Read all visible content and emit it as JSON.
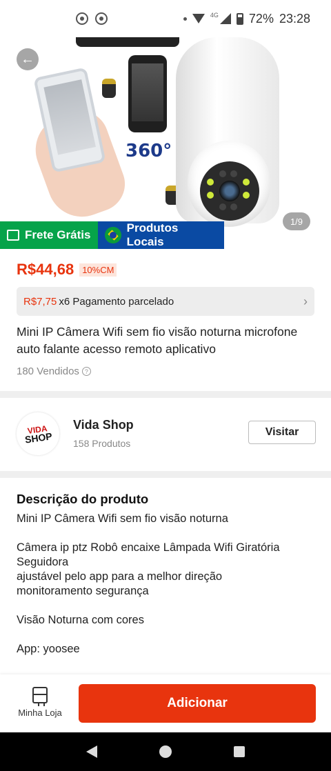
{
  "status_bar": {
    "battery": "72%",
    "time": "23:28",
    "network": "4G"
  },
  "gallery": {
    "counter": "1/9",
    "badge_text": "360°"
  },
  "tags": {
    "free_shipping": "Frete Grátis",
    "local_products": "Produtos Locais"
  },
  "product": {
    "price": "R$44,68",
    "discount": "10%CM",
    "installment_amount": "R$7,75",
    "installment_text": "x6 Pagamento parcelado",
    "title": "Mini IP Câmera Wifi sem fio visão noturna microfone auto falante acesso remoto aplicativo",
    "sold": "180 Vendidos"
  },
  "shop": {
    "logo_line1": "VIDA",
    "logo_line2": "SHOP",
    "name": "Vida Shop",
    "product_count": "158 Produtos",
    "visit_label": "Visitar"
  },
  "description": {
    "heading": "Descrição do produto",
    "line1": "Mini IP Câmera Wifi sem fio visão noturna",
    "line2": "Câmera ip ptz Robô encaixe Lâmpada Wifi Giratória Seguidora",
    "line3": "ajustável pelo app para a melhor direção",
    "line4": "monitoramento segurança",
    "line5": "Visão Noturna com cores",
    "line6": "App: yoosee"
  },
  "actions": {
    "store_label": "Minha Loja",
    "add_label": "Adicionar"
  },
  "colors": {
    "accent": "#e8340e",
    "free_shipping_bg": "#06a34a",
    "local_products_bg": "#0a4aa3"
  }
}
